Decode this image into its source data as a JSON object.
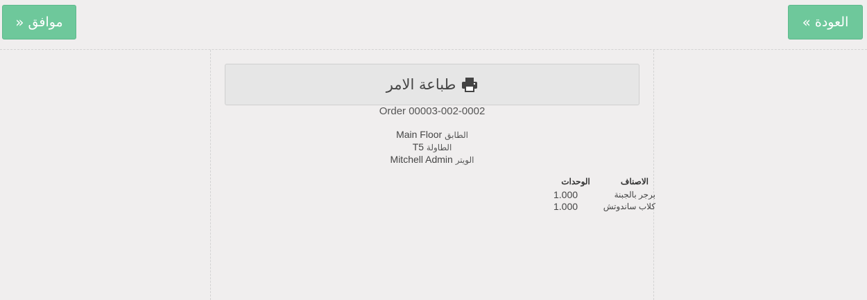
{
  "header": {
    "ok_label": "موافق",
    "back_label": "العودة",
    "ok_icon": "double-chevron-icon",
    "back_icon": "double-chevron-icon",
    "button_color": "#6ec89b"
  },
  "print_button": {
    "label": "طباعة الامر",
    "icon": "printer-icon"
  },
  "receipt": {
    "order_number": "Order 00003-002-0002",
    "floor": {
      "label": "الطابق",
      "value": "Main Floor"
    },
    "table": {
      "label": "الطاولة",
      "value": "T5"
    },
    "waiter": {
      "label": "الويتر",
      "value": "Mitchell Admin"
    },
    "columns": {
      "item": "الاصناف",
      "qty": "الوحدات"
    },
    "lines": [
      {
        "name": "برجر بالجبنة",
        "qty": "1.000"
      },
      {
        "name": "كلاب ساندوتش",
        "qty": "1.000"
      }
    ]
  }
}
